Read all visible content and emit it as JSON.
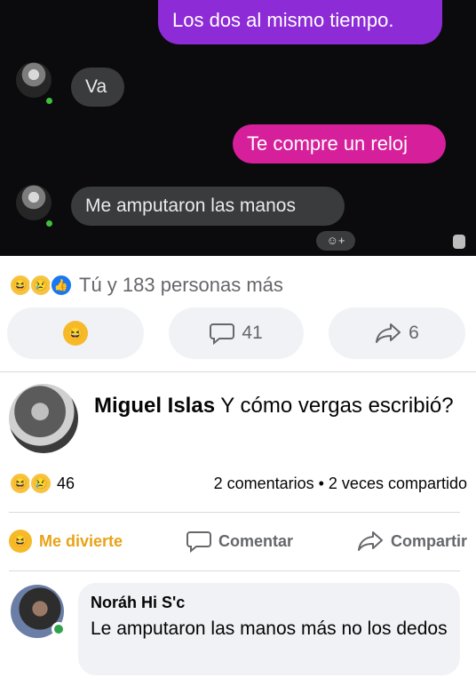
{
  "chat": {
    "messages": [
      {
        "text": "Los dos al mismo tiempo.",
        "direction": "out",
        "color": "#8d2bd6"
      },
      {
        "text": "Va",
        "direction": "in"
      },
      {
        "text": "Te compre un reloj",
        "direction": "out",
        "color": "#d61f9b"
      },
      {
        "text": "Me amputaron las manos",
        "direction": "in"
      }
    ],
    "react_add_label": "☺+"
  },
  "post": {
    "reaction_icons": [
      "haha-icon",
      "sad-icon",
      "like-icon"
    ],
    "reaction_summary": "Tú y 183 personas más",
    "comment_count": "41",
    "share_count": "6"
  },
  "top_comment": {
    "author": "Miguel Islas",
    "text": " Y cómo vergas escribió?",
    "reaction_count": "46",
    "stats_text": "2 comentarios • 2 veces compartido"
  },
  "actions": {
    "react_label": "Me divierte",
    "comment_label": "Comentar",
    "share_label": "Compartir",
    "active_color": "#e8a317"
  },
  "reply": {
    "author": "Noráh Hi S'c",
    "text": "Le amputaron las manos más no los dedos"
  }
}
